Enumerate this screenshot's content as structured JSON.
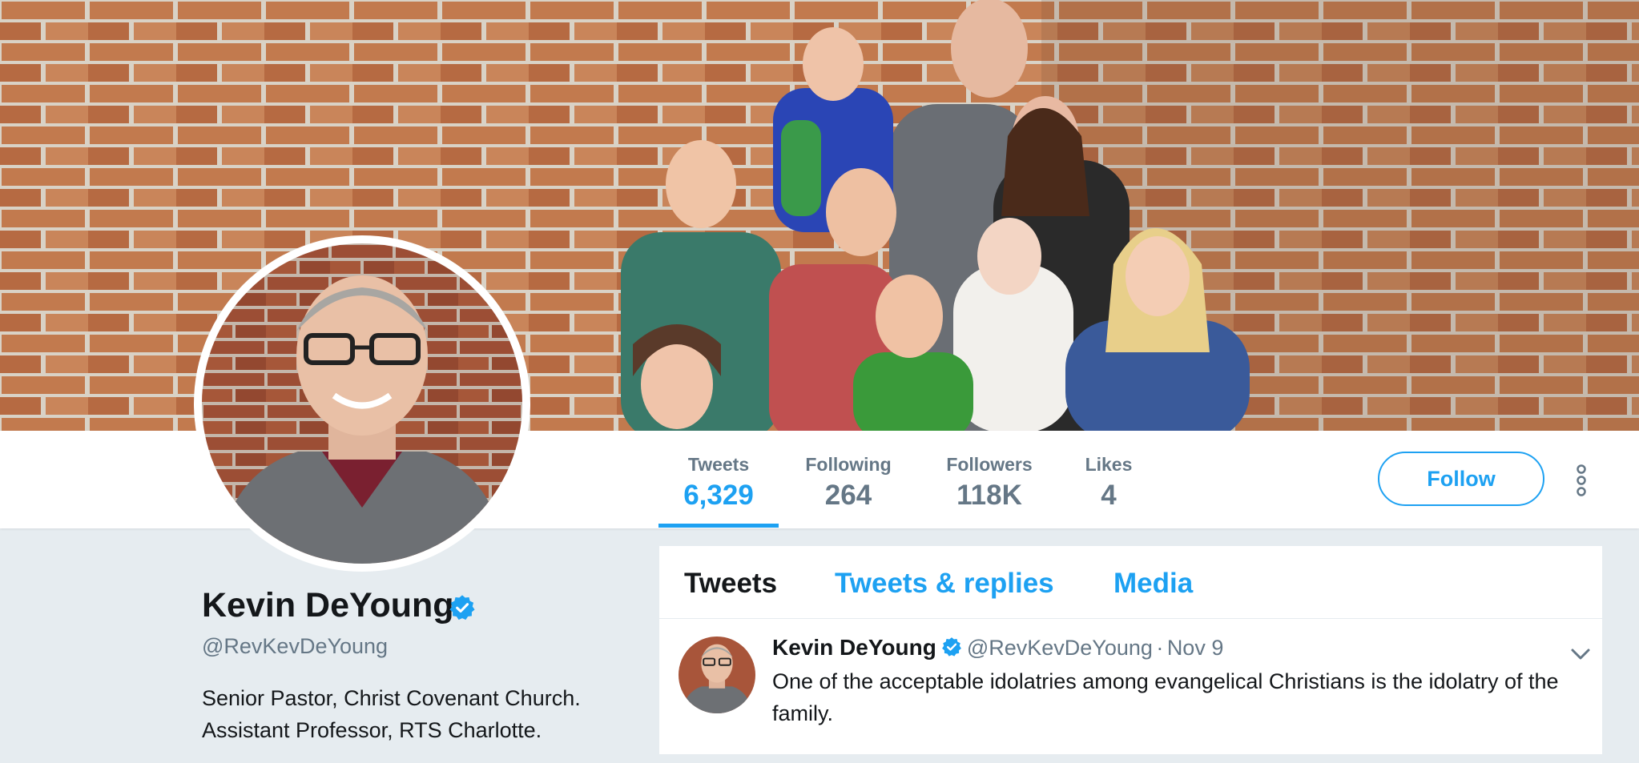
{
  "profile": {
    "name": "Kevin DeYoung",
    "handle": "@RevKevDeYoung",
    "bio_lines": [
      "Senior Pastor, Christ Covenant Church.",
      "Assistant Professor, RTS Charlotte."
    ]
  },
  "stats": [
    {
      "label": "Tweets",
      "value": "6,329"
    },
    {
      "label": "Following",
      "value": "264"
    },
    {
      "label": "Followers",
      "value": "118K"
    },
    {
      "label": "Likes",
      "value": "4"
    }
  ],
  "actions": {
    "follow_label": "Follow"
  },
  "tabs": [
    {
      "label": "Tweets"
    },
    {
      "label": "Tweets & replies"
    },
    {
      "label": "Media"
    }
  ],
  "tweet": {
    "name": "Kevin DeYoung",
    "handle": "@RevKevDeYoung",
    "separator": "·",
    "time": "Nov 9",
    "text": "One of the acceptable idolatries among evangelical Christians is the idolatry of the family."
  },
  "colors": {
    "accent": "#1da1f2",
    "muted_text": "#657786",
    "page_background": "#e6ecf0"
  },
  "icons": [
    "verified-badge-icon",
    "more-vertical-icon",
    "chevron-down-icon"
  ]
}
